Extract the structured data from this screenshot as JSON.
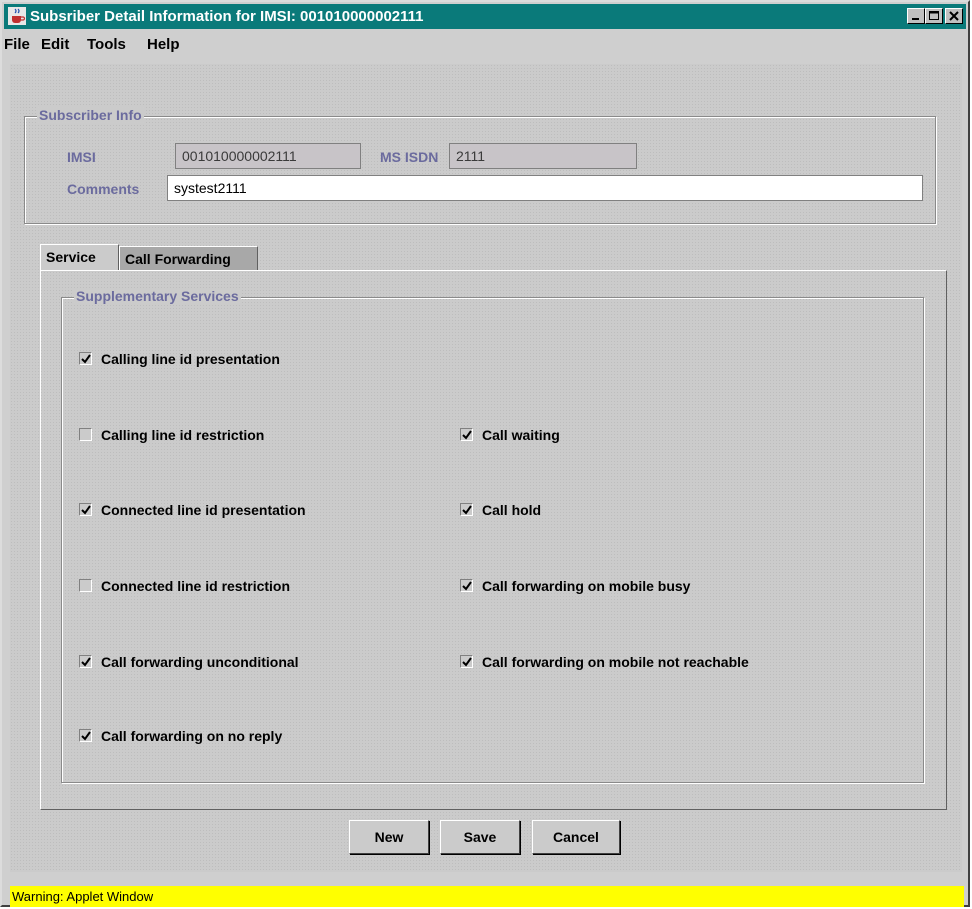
{
  "window": {
    "title": "Subsriber Detail Information for IMSI: 001010000002111"
  },
  "menu": {
    "file": "File",
    "edit": "Edit",
    "tools": "Tools",
    "help": "Help"
  },
  "subscriber_info": {
    "legend": "Subscriber Info",
    "imsi_label": "IMSI",
    "imsi_value": "001010000002111",
    "msisdn_label": "MS ISDN",
    "msisdn_value": "2111",
    "comments_label": "Comments",
    "comments_value": "systest2111"
  },
  "tabs": {
    "service": "Service",
    "call_forwarding": "Call Forwarding"
  },
  "supplementary": {
    "legend": "Supplementary Services",
    "items": [
      {
        "label": "Calling line id presentation",
        "checked": true
      },
      {
        "label": "Calling line id restriction",
        "checked": false
      },
      {
        "label": "Call waiting",
        "checked": true
      },
      {
        "label": "Connected line id presentation",
        "checked": true
      },
      {
        "label": "Call hold",
        "checked": true
      },
      {
        "label": "Connected line id restriction",
        "checked": false
      },
      {
        "label": "Call forwarding on mobile busy",
        "checked": true
      },
      {
        "label": "Call forwarding unconditional",
        "checked": true
      },
      {
        "label": "Call forwarding on mobile not reachable",
        "checked": true
      },
      {
        "label": "Call forwarding on no reply",
        "checked": true
      }
    ]
  },
  "buttons": {
    "new": "New",
    "save": "Save",
    "cancel": "Cancel"
  },
  "status": {
    "text": "Warning: Applet Window"
  },
  "colors": {
    "title_bar": "#0a7a7a",
    "label_text": "#6b6b9e",
    "status_bar": "#ffff00"
  }
}
